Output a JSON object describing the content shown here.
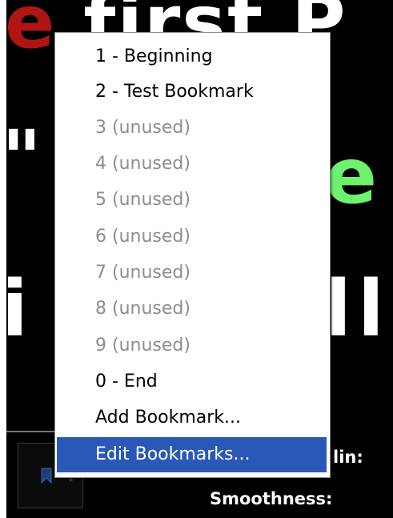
{
  "background": {
    "line1_red": "e",
    "line1_white": " first P",
    "line2_quote": "\"",
    "line2_green": "e",
    "line3_left": "i",
    "line3_right": "ll",
    "bottom_labels": {
      "min_label": "lin:",
      "smoothness_label": "Smoothness:"
    },
    "toolbar_icon": "bookmark-icon"
  },
  "menu": {
    "items": [
      {
        "label": "1 - Beginning",
        "enabled": true
      },
      {
        "label": "2 - Test Bookmark",
        "enabled": true
      },
      {
        "label": "3 (unused)",
        "enabled": false
      },
      {
        "label": "4 (unused)",
        "enabled": false
      },
      {
        "label": "5 (unused)",
        "enabled": false
      },
      {
        "label": "6 (unused)",
        "enabled": false
      },
      {
        "label": "7 (unused)",
        "enabled": false
      },
      {
        "label": "8 (unused)",
        "enabled": false
      },
      {
        "label": "9 (unused)",
        "enabled": false
      },
      {
        "label": "0 - End",
        "enabled": true
      },
      {
        "label": "Add Bookmark...",
        "enabled": true
      },
      {
        "label": "Edit Bookmarks...",
        "enabled": true,
        "selected": true
      }
    ]
  },
  "colors": {
    "highlight": "#2a58b8",
    "disabled_text": "#8d8d8d",
    "accent_green": "#6cf26c",
    "accent_red": "#b01515"
  }
}
